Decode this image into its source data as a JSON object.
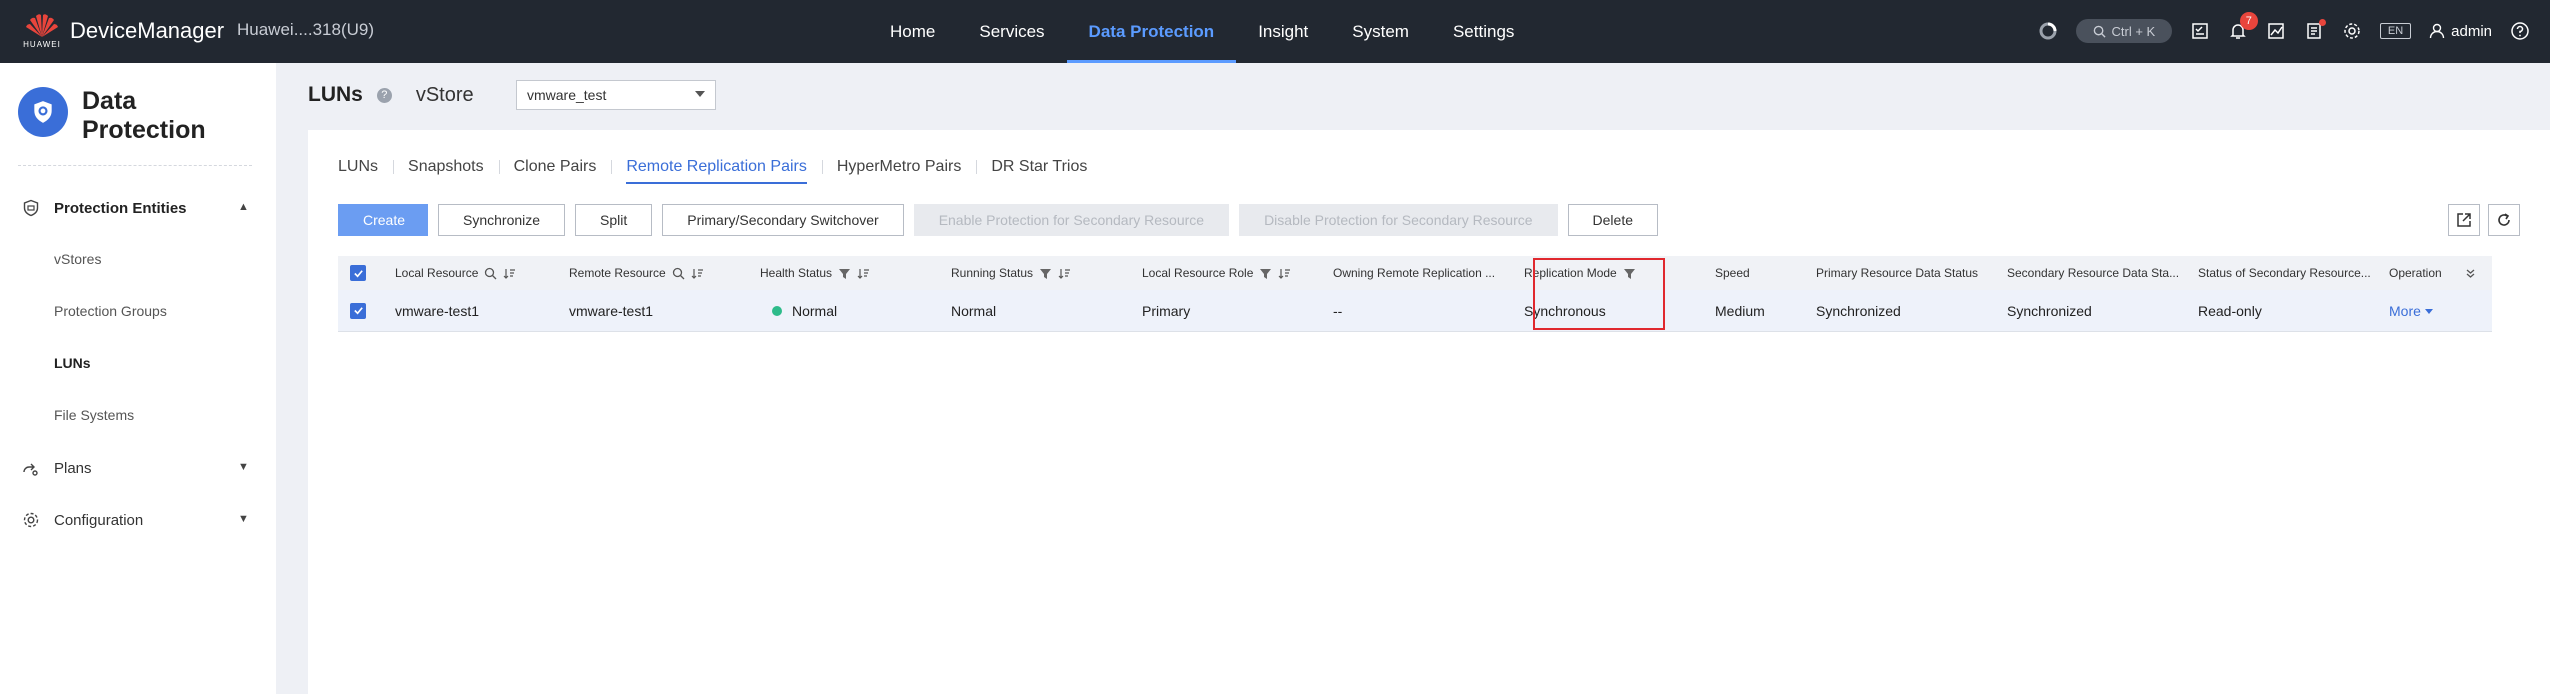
{
  "topbar": {
    "brand": "HUAWEI",
    "app_name": "DeviceManager",
    "device_name": "Huawei....318(U9)",
    "nav": [
      "Home",
      "Services",
      "Data Protection",
      "Insight",
      "System",
      "Settings"
    ],
    "active_nav": "Data Protection",
    "search_shortcut": "Ctrl + K",
    "notification_count": "7",
    "language": "EN",
    "user": "admin",
    "accent_color": "#5b9bff"
  },
  "sidebar": {
    "title_line1": "Data",
    "title_line2": "Protection",
    "groups": {
      "protection_entities": "Protection Entities",
      "plans": "Plans",
      "configuration": "Configuration"
    },
    "items": [
      "vStores",
      "Protection Groups",
      "LUNs",
      "File Systems"
    ],
    "active_item": "LUNs"
  },
  "header": {
    "title": "LUNs",
    "vstore_label": "vStore",
    "vstore_value": "vmware_test"
  },
  "tabs": [
    "LUNs",
    "Snapshots",
    "Clone Pairs",
    "Remote Replication Pairs",
    "HyperMetro Pairs",
    "DR Star Trios"
  ],
  "active_tab": "Remote Replication Pairs",
  "toolbar": {
    "create": "Create",
    "synchronize": "Synchronize",
    "split": "Split",
    "switchover": "Primary/Secondary Switchover",
    "enable_protection": "Enable Protection for Secondary Resource",
    "disable_protection": "Disable Protection for Secondary Resource",
    "delete": "Delete"
  },
  "table": {
    "columns": [
      "Local Resource",
      "Remote Resource",
      "Health Status",
      "Running Status",
      "Local Resource Role",
      "Owning Remote Replication ...",
      "Replication Mode",
      "Speed",
      "Primary Resource Data Status",
      "Secondary Resource Data Sta...",
      "Status of Secondary Resource...",
      "Operation"
    ],
    "rows": [
      [
        "vmware-test1",
        "vmware-test1",
        "Normal",
        "Normal",
        "Primary",
        "--",
        "Synchronous",
        "Medium",
        "Synchronized",
        "Synchronized",
        "Read-only",
        "More"
      ]
    ],
    "health_color": "#2dbb8a"
  }
}
